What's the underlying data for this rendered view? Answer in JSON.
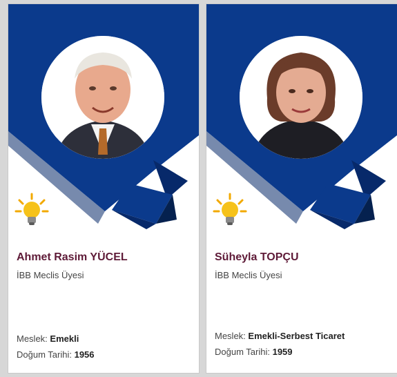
{
  "cards": [
    {
      "name": "Ahmet Rasim YÜCEL",
      "role": "İBB Meclis Üyesi",
      "occupation_label": "Meslek:",
      "occupation": "Emekli",
      "birth_label": "Doğum Tarihi:",
      "birth_year": "1956",
      "photo_icon": "person-photo"
    },
    {
      "name": "Süheyla TOPÇU",
      "role": "İBB Meclis Üyesi",
      "occupation_label": "Meslek:",
      "occupation": "Emekli-Serbest Ticaret",
      "birth_label": "Doğum Tarihi:",
      "birth_year": "1959",
      "photo_icon": "person-photo"
    }
  ],
  "logo_icon": "party-bulb-logo",
  "colors": {
    "banner": "#0b3a8c",
    "banner_dark": "#07296a",
    "name": "#5e1a37",
    "background": "#d7d7d7"
  }
}
